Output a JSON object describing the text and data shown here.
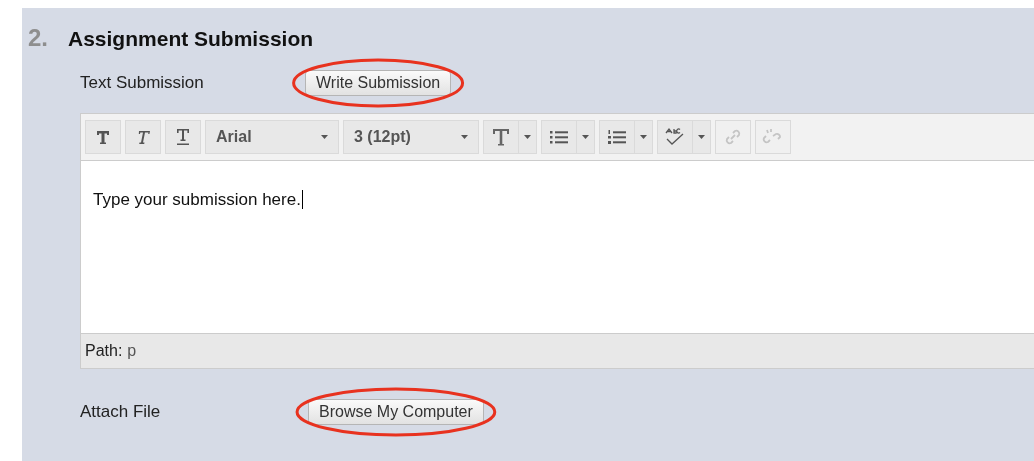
{
  "section": {
    "number": "2.",
    "title": "Assignment Submission"
  },
  "text_submission": {
    "label": "Text Submission",
    "button": "Write Submission",
    "highlighted": true
  },
  "toolbar": [
    {
      "kind": "bold",
      "disabled": false
    },
    {
      "kind": "italic",
      "disabled": false
    },
    {
      "kind": "underline",
      "disabled": false
    },
    {
      "kind": "select",
      "value": "Arial"
    },
    {
      "kind": "select",
      "value": "3 (12pt)"
    },
    {
      "kind": "color",
      "disabled": false
    },
    {
      "kind": "bullets",
      "disabled": false
    },
    {
      "kind": "numbers",
      "disabled": false
    },
    {
      "kind": "spell",
      "disabled": false
    },
    {
      "kind": "link",
      "disabled": true
    },
    {
      "kind": "unlink",
      "disabled": true
    }
  ],
  "editor": {
    "value": "Type your submission here.",
    "path_label": "Path:",
    "path_value": "p"
  },
  "attach_file": {
    "label": "Attach File",
    "button": "Browse My Computer",
    "highlighted": true
  }
}
